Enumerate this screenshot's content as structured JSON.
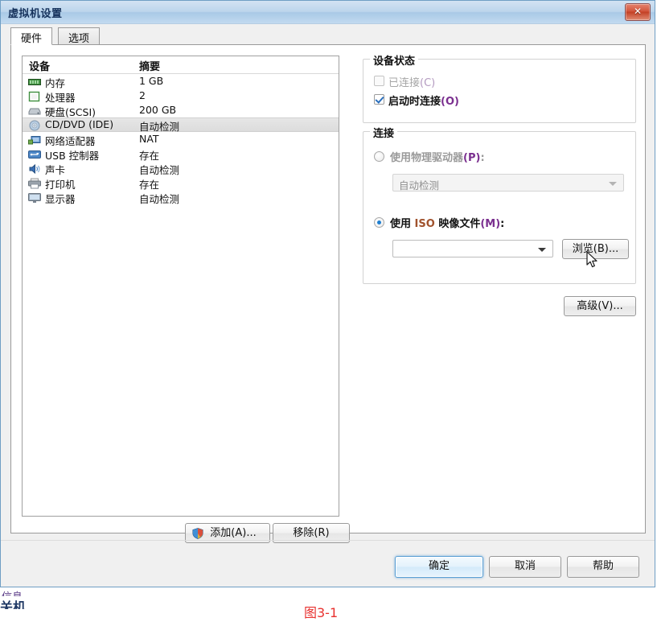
{
  "window": {
    "title": "虚拟机设置",
    "close_label": "✕"
  },
  "tabs": [
    {
      "label": "硬件",
      "active": true
    },
    {
      "label": "选项",
      "active": false
    }
  ],
  "device_table": {
    "headers": {
      "device": "设备",
      "summary": "摘要"
    },
    "rows": [
      {
        "icon": "memory-icon",
        "name": "内存",
        "summary": "1 GB",
        "selected": false
      },
      {
        "icon": "processor-icon",
        "name": "处理器",
        "summary": "2",
        "selected": false
      },
      {
        "icon": "harddisk-icon",
        "name": "硬盘(SCSI)",
        "summary": "200 GB",
        "selected": false
      },
      {
        "icon": "cddvd-icon",
        "name": "CD/DVD (IDE)",
        "summary": "自动检测",
        "selected": true
      },
      {
        "icon": "network-icon",
        "name": "网络适配器",
        "summary": "NAT",
        "selected": false
      },
      {
        "icon": "usb-icon",
        "name": "USB 控制器",
        "summary": "存在",
        "selected": false
      },
      {
        "icon": "sound-icon",
        "name": "声卡",
        "summary": "自动检测",
        "selected": false
      },
      {
        "icon": "printer-icon",
        "name": "打印机",
        "summary": "存在",
        "selected": false
      },
      {
        "icon": "display-icon",
        "name": "显示器",
        "summary": "自动检测",
        "selected": false
      }
    ]
  },
  "list_buttons": {
    "add": "添加(A)...",
    "remove": "移除(R)"
  },
  "device_status": {
    "group_title": "设备状态",
    "connected": {
      "label": "已连接(C)",
      "checked": false,
      "disabled": true
    },
    "connect_at_power_on": {
      "label": "启动时连接(O)",
      "checked": true,
      "disabled": false
    }
  },
  "connection": {
    "group_title": "连接",
    "physical_drive": {
      "label": "使用物理驱动器(P):",
      "selected": false,
      "combo_value": "自动检测",
      "combo_disabled": true
    },
    "iso_image": {
      "label": "使用 ISO 映像文件(M):",
      "selected": true,
      "combo_value": "",
      "combo_placeholder": "",
      "browse_label": "浏览(B)..."
    }
  },
  "advanced_button": "高级(V)...",
  "footer_buttons": {
    "ok": "确定",
    "cancel": "取消",
    "help": "帮助"
  },
  "background": {
    "line1": "信息",
    "line2": "关机",
    "line3": "",
    "figure_caption": "图3-1"
  },
  "colors": {
    "titlebar_accent": "#a9c9e6",
    "close_button": "#c34024",
    "default_button_border": "#5a9fd4",
    "selection": "#e0e0e0",
    "accent_key": "#7a2f8f",
    "caption_red": "#e8312f"
  }
}
